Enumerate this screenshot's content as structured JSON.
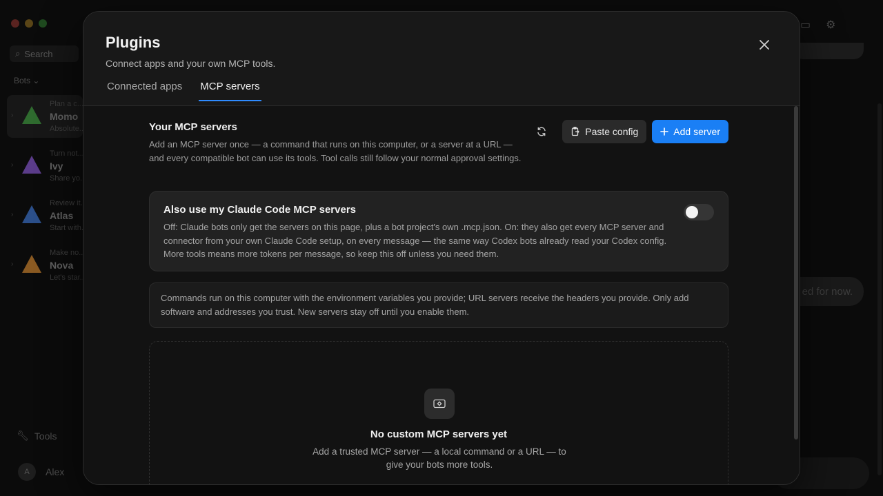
{
  "background": {
    "search_placeholder": "Search",
    "section_label": "Bots",
    "bots": [
      {
        "preview": "Plan a c...",
        "name": "Momo",
        "sub": "Absolute...",
        "color": "#2f6b2f"
      },
      {
        "preview": "Turn not...",
        "name": "Ivy",
        "sub": "Share yo...",
        "color": "#5b3c8a"
      },
      {
        "preview": "Review it...",
        "name": "Atlas",
        "sub": "Start with...",
        "color": "#2b4f8a"
      },
      {
        "preview": "Make no...",
        "name": "Nova",
        "sub": "Let's star...",
        "color": "#8a5a22"
      }
    ],
    "tools_label": "Tools",
    "user_name": "Alex",
    "user_initial": "A",
    "chat_snippet": "ed for now."
  },
  "modal": {
    "title": "Plugins",
    "subtitle": "Connect apps and your own MCP tools.",
    "tabs": [
      {
        "label": "Connected apps",
        "active": false
      },
      {
        "label": "MCP servers",
        "active": true
      }
    ]
  },
  "servers": {
    "title": "Your MCP servers",
    "description": "Add an MCP server once — a command that runs on this computer, or a server at a URL — and every compatible bot can use its tools. Tool calls still follow your normal approval settings.",
    "paste_config_label": "Paste config",
    "add_server_label": "Add server"
  },
  "claude_code": {
    "title": "Also use my Claude Code MCP servers",
    "description": "Off: Claude bots only get the servers on this page, plus a bot project's own .mcp.json. On: they also get every MCP server and connector from your own Claude Code setup, on every message — the same way Codex bots already read your Codex config. More tools means more tokens per message, so keep this off unless you need them.",
    "enabled": false
  },
  "security_note": "Commands run on this computer with the environment variables you provide; URL servers receive the headers you provide. Only add software and addresses you trust. New servers stay off until you enable them.",
  "empty_state": {
    "title": "No custom MCP servers yet",
    "description": "Add a trusted MCP server — a local command or a URL — to give your bots more tools."
  },
  "colors": {
    "accent": "#1a7ff5",
    "tab_underline": "#2f8bff"
  }
}
